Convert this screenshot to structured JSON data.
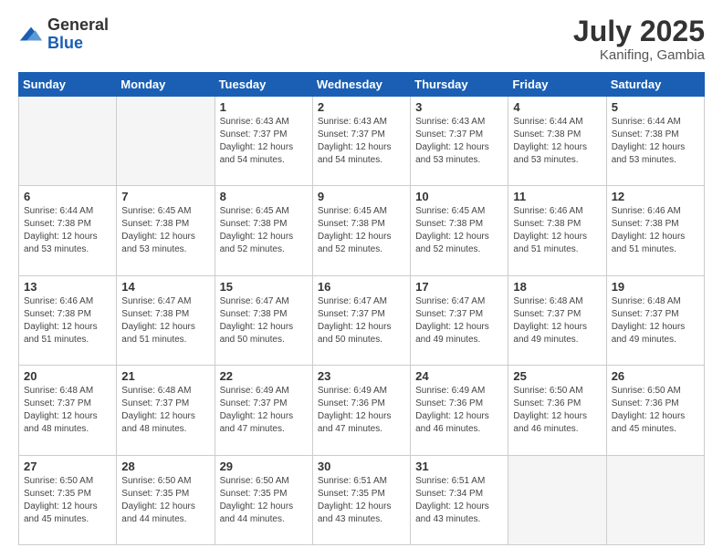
{
  "header": {
    "logo_general": "General",
    "logo_blue": "Blue",
    "month_year": "July 2025",
    "location": "Kanifing, Gambia"
  },
  "days_of_week": [
    "Sunday",
    "Monday",
    "Tuesday",
    "Wednesday",
    "Thursday",
    "Friday",
    "Saturday"
  ],
  "weeks": [
    [
      {
        "day": "",
        "empty": true
      },
      {
        "day": "",
        "empty": true
      },
      {
        "day": "1",
        "sunrise": "6:43 AM",
        "sunset": "7:37 PM",
        "daylight": "12 hours and 54 minutes."
      },
      {
        "day": "2",
        "sunrise": "6:43 AM",
        "sunset": "7:37 PM",
        "daylight": "12 hours and 54 minutes."
      },
      {
        "day": "3",
        "sunrise": "6:43 AM",
        "sunset": "7:37 PM",
        "daylight": "12 hours and 53 minutes."
      },
      {
        "day": "4",
        "sunrise": "6:44 AM",
        "sunset": "7:38 PM",
        "daylight": "12 hours and 53 minutes."
      },
      {
        "day": "5",
        "sunrise": "6:44 AM",
        "sunset": "7:38 PM",
        "daylight": "12 hours and 53 minutes."
      }
    ],
    [
      {
        "day": "6",
        "sunrise": "6:44 AM",
        "sunset": "7:38 PM",
        "daylight": "12 hours and 53 minutes."
      },
      {
        "day": "7",
        "sunrise": "6:45 AM",
        "sunset": "7:38 PM",
        "daylight": "12 hours and 53 minutes."
      },
      {
        "day": "8",
        "sunrise": "6:45 AM",
        "sunset": "7:38 PM",
        "daylight": "12 hours and 52 minutes."
      },
      {
        "day": "9",
        "sunrise": "6:45 AM",
        "sunset": "7:38 PM",
        "daylight": "12 hours and 52 minutes."
      },
      {
        "day": "10",
        "sunrise": "6:45 AM",
        "sunset": "7:38 PM",
        "daylight": "12 hours and 52 minutes."
      },
      {
        "day": "11",
        "sunrise": "6:46 AM",
        "sunset": "7:38 PM",
        "daylight": "12 hours and 51 minutes."
      },
      {
        "day": "12",
        "sunrise": "6:46 AM",
        "sunset": "7:38 PM",
        "daylight": "12 hours and 51 minutes."
      }
    ],
    [
      {
        "day": "13",
        "sunrise": "6:46 AM",
        "sunset": "7:38 PM",
        "daylight": "12 hours and 51 minutes."
      },
      {
        "day": "14",
        "sunrise": "6:47 AM",
        "sunset": "7:38 PM",
        "daylight": "12 hours and 51 minutes."
      },
      {
        "day": "15",
        "sunrise": "6:47 AM",
        "sunset": "7:38 PM",
        "daylight": "12 hours and 50 minutes."
      },
      {
        "day": "16",
        "sunrise": "6:47 AM",
        "sunset": "7:37 PM",
        "daylight": "12 hours and 50 minutes."
      },
      {
        "day": "17",
        "sunrise": "6:47 AM",
        "sunset": "7:37 PM",
        "daylight": "12 hours and 49 minutes."
      },
      {
        "day": "18",
        "sunrise": "6:48 AM",
        "sunset": "7:37 PM",
        "daylight": "12 hours and 49 minutes."
      },
      {
        "day": "19",
        "sunrise": "6:48 AM",
        "sunset": "7:37 PM",
        "daylight": "12 hours and 49 minutes."
      }
    ],
    [
      {
        "day": "20",
        "sunrise": "6:48 AM",
        "sunset": "7:37 PM",
        "daylight": "12 hours and 48 minutes."
      },
      {
        "day": "21",
        "sunrise": "6:48 AM",
        "sunset": "7:37 PM",
        "daylight": "12 hours and 48 minutes."
      },
      {
        "day": "22",
        "sunrise": "6:49 AM",
        "sunset": "7:37 PM",
        "daylight": "12 hours and 47 minutes."
      },
      {
        "day": "23",
        "sunrise": "6:49 AM",
        "sunset": "7:36 PM",
        "daylight": "12 hours and 47 minutes."
      },
      {
        "day": "24",
        "sunrise": "6:49 AM",
        "sunset": "7:36 PM",
        "daylight": "12 hours and 46 minutes."
      },
      {
        "day": "25",
        "sunrise": "6:50 AM",
        "sunset": "7:36 PM",
        "daylight": "12 hours and 46 minutes."
      },
      {
        "day": "26",
        "sunrise": "6:50 AM",
        "sunset": "7:36 PM",
        "daylight": "12 hours and 45 minutes."
      }
    ],
    [
      {
        "day": "27",
        "sunrise": "6:50 AM",
        "sunset": "7:35 PM",
        "daylight": "12 hours and 45 minutes."
      },
      {
        "day": "28",
        "sunrise": "6:50 AM",
        "sunset": "7:35 PM",
        "daylight": "12 hours and 44 minutes."
      },
      {
        "day": "29",
        "sunrise": "6:50 AM",
        "sunset": "7:35 PM",
        "daylight": "12 hours and 44 minutes."
      },
      {
        "day": "30",
        "sunrise": "6:51 AM",
        "sunset": "7:35 PM",
        "daylight": "12 hours and 43 minutes."
      },
      {
        "day": "31",
        "sunrise": "6:51 AM",
        "sunset": "7:34 PM",
        "daylight": "12 hours and 43 minutes."
      },
      {
        "day": "",
        "empty": true
      },
      {
        "day": "",
        "empty": true
      }
    ]
  ],
  "labels": {
    "sunrise_prefix": "Sunrise: ",
    "sunset_prefix": "Sunset: ",
    "daylight_prefix": "Daylight: "
  }
}
